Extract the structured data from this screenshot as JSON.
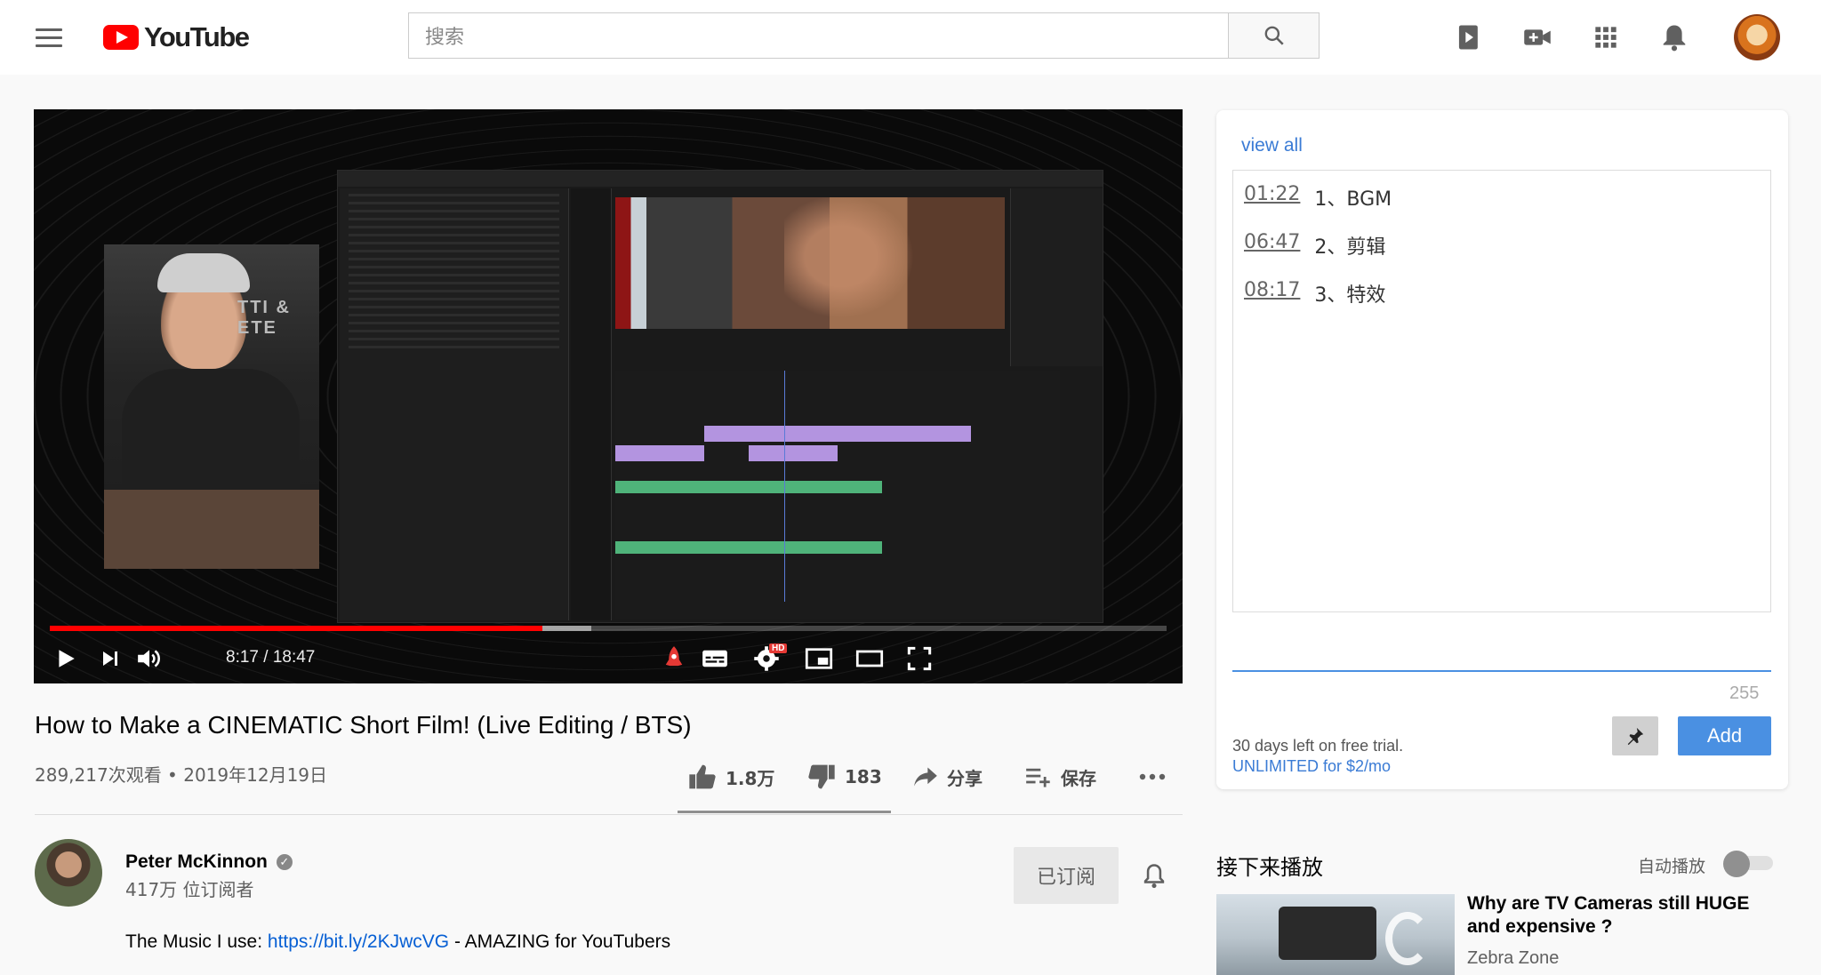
{
  "header": {
    "logo_text": "YouTube",
    "search_placeholder": "搜索",
    "icons": [
      "menu-icon",
      "search-icon",
      "play-queue-icon",
      "create-video-icon",
      "apps-grid-icon",
      "notifications-bell-icon",
      "user-avatar"
    ]
  },
  "player": {
    "current_time": "8:17",
    "duration": "18:47",
    "time_display": "8:17 / 18:47",
    "progress_played_fraction": 0.441,
    "progress_buffered_fraction": 0.485,
    "overlay_text": "TTI & ETE",
    "controls": [
      "play-icon",
      "next-icon",
      "volume-icon",
      "rocket-icon",
      "subtitles-icon",
      "settings-hd-icon",
      "miniplayer-icon",
      "theater-mode-icon",
      "fullscreen-icon"
    ],
    "hd_badge": "HD",
    "colors": {
      "progress": "#ff0000",
      "rocket": "#e53935"
    }
  },
  "video": {
    "title": "How to Make a CINEMATIC Short Film! (Live Editing / BTS)",
    "meta": "289,217次观看 • 2019年12月19日",
    "likes": "1.8万",
    "dislikes": "183",
    "share_label": "分享",
    "save_label": "保存"
  },
  "channel": {
    "name": "Peter McKinnon",
    "subscribers": "417万 位订阅者",
    "subscribed_label": "已订阅",
    "desc_prefix": "The Music I use: ",
    "desc_link": "https://bit.ly/2KJwcVG",
    "desc_suffix": " - AMAZING for YouTubers"
  },
  "timestamps_panel": {
    "view_all": "view all",
    "items": [
      {
        "time": "01:22",
        "label": "1、BGM"
      },
      {
        "time": "06:47",
        "label": "2、剪辑"
      },
      {
        "time": "08:17",
        "label": "3、特效"
      }
    ],
    "char_count": "255",
    "add_label": "Add",
    "trial_text": "30 days left on free trial.",
    "unlimited_link": "UNLIMITED for $2/mo",
    "colors": {
      "accent": "#4a90e2"
    }
  },
  "up_next": {
    "heading": "接下来播放",
    "autoplay_label": "自动播放",
    "autoplay_on": false,
    "next_video": {
      "title": "Why are TV Cameras still HUGE and expensive ?",
      "channel": "Zebra Zone"
    }
  }
}
